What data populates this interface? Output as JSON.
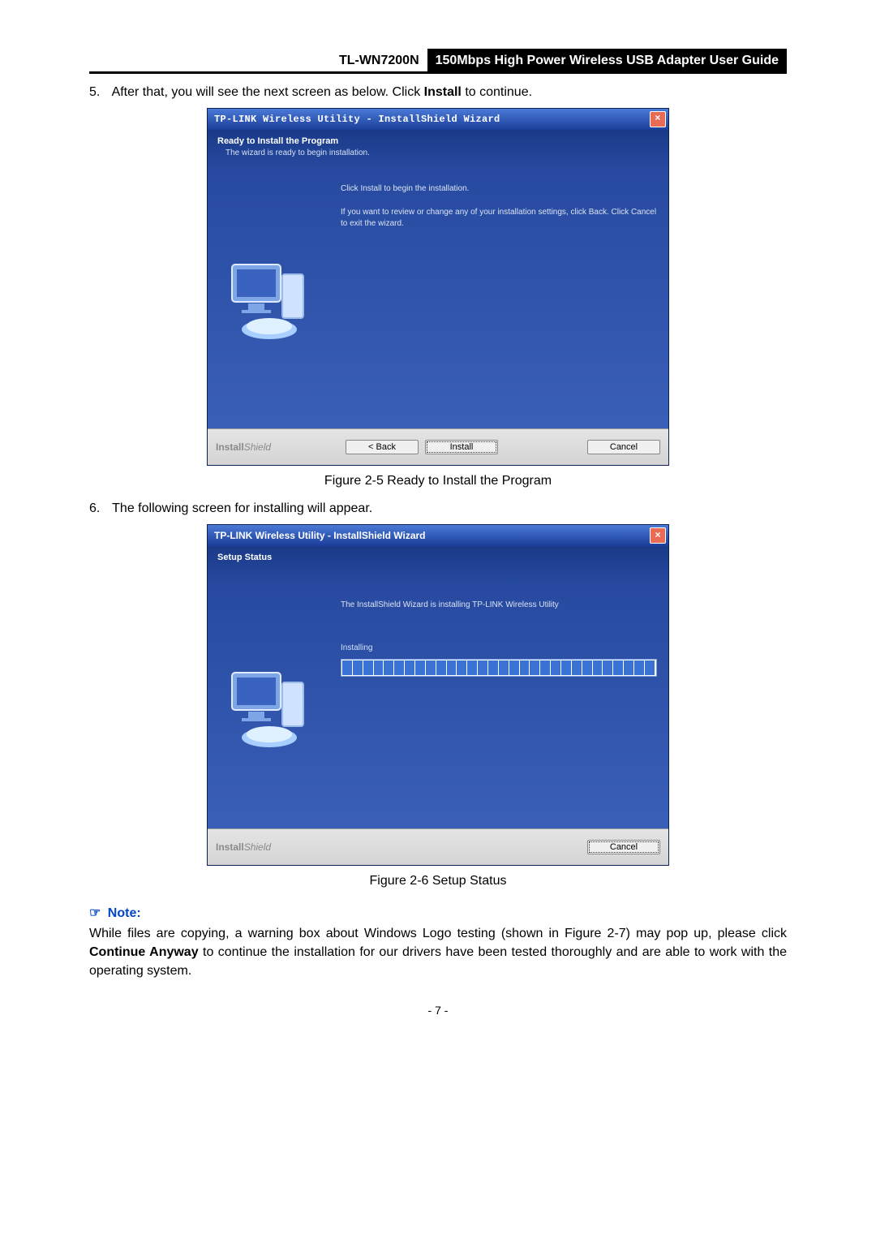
{
  "header": {
    "model": "TL-WN7200N",
    "title": "150Mbps High Power Wireless USB Adapter User Guide"
  },
  "step5": {
    "number": "5.",
    "text_a": "After that, you will see the next screen as below. Click ",
    "bold": "Install",
    "text_b": " to continue."
  },
  "wizard1": {
    "title": "TP-LINK Wireless Utility - InstallShield Wizard",
    "heading": "Ready to Install the Program",
    "subheading": "The wizard is ready to begin installation.",
    "line1": "Click Install to begin the installation.",
    "line2": "If you want to review or change any of your installation settings, click Back. Click Cancel to exit the wizard.",
    "brand_a": "Install",
    "brand_b": "Shield",
    "btn_back": "< Back",
    "btn_install": "Install",
    "btn_cancel": "Cancel"
  },
  "caption1": "Figure 2-5 Ready to Install the Program",
  "step6": {
    "number": "6.",
    "text": "The following screen for installing will appear."
  },
  "wizard2": {
    "title": "TP-LINK Wireless Utility - InstallShield Wizard",
    "heading": "Setup Status",
    "line1": "The InstallShield Wizard is installing TP-LINK Wireless Utility",
    "installing": "Installing",
    "brand_a": "Install",
    "brand_b": "Shield",
    "btn_cancel": "Cancel"
  },
  "caption2": "Figure 2-6 Setup Status",
  "note": {
    "icon": "☞",
    "label": "Note:",
    "body_a": "While files are copying, a warning box about Windows Logo testing (shown in Figure 2-7) may pop up, please click ",
    "bold": "Continue Anyway",
    "body_b": " to continue the installation for our drivers have been tested thoroughly and are able to work with the operating system."
  },
  "page_num": "- 7 -"
}
